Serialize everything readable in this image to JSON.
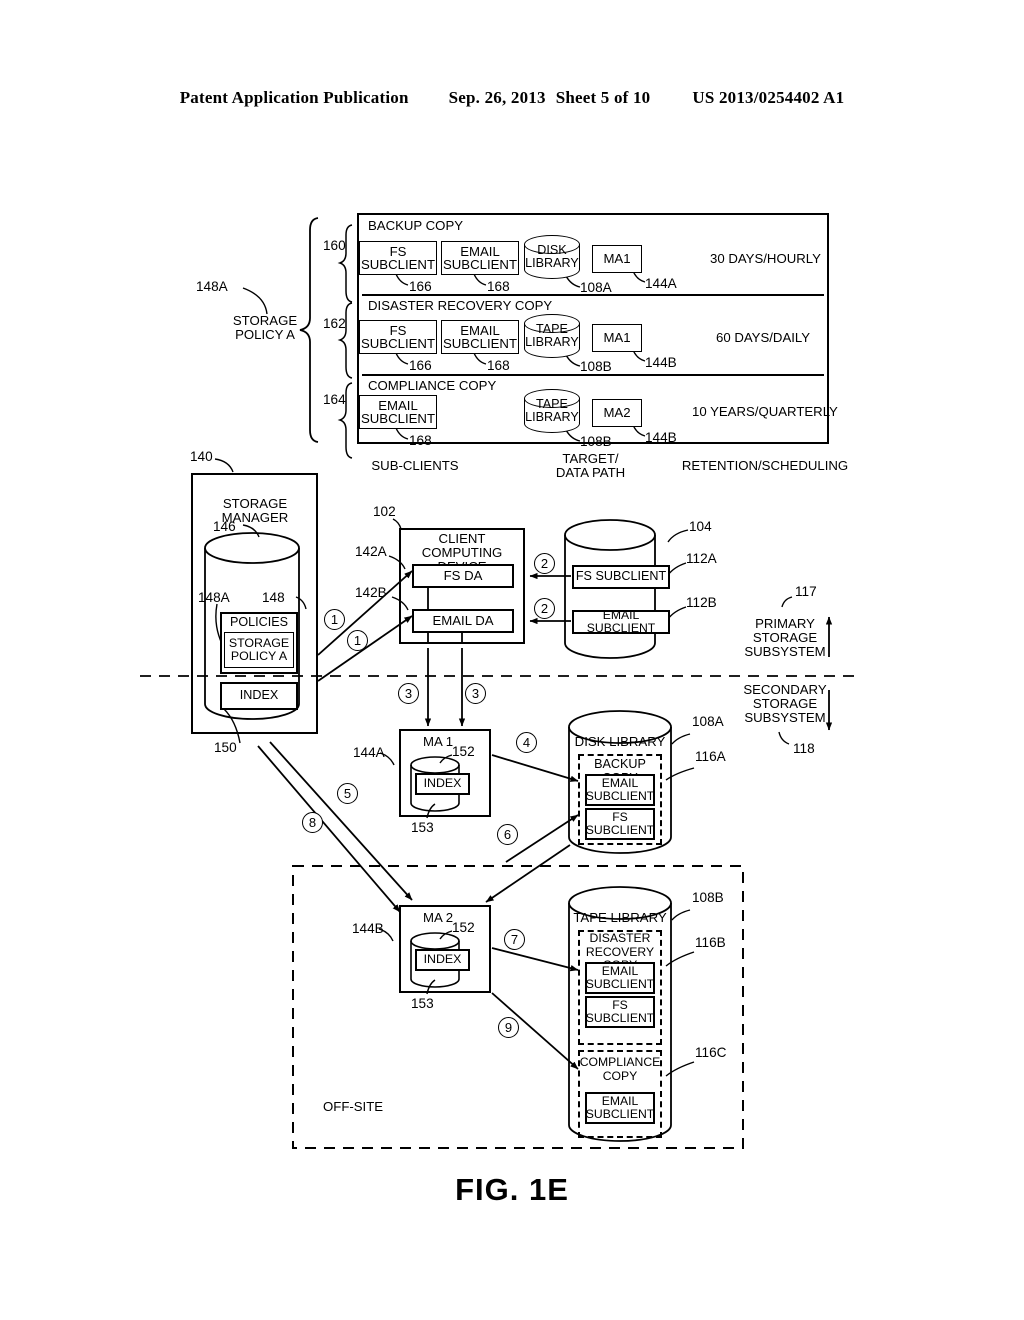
{
  "header": {
    "publication": "Patent Application Publication",
    "date": "Sep. 26, 2013",
    "sheet": "Sheet 5 of 10",
    "patent_number": "US 2013/0254402 A1"
  },
  "figure_caption": "FIG. 1E",
  "storage_policy": {
    "label_line1": "STORAGE",
    "label_line2": "POLICY A",
    "ref": "148A",
    "column_headers": {
      "subclients": "SUB-CLIENTS",
      "target_line1": "TARGET/",
      "target_line2": "DATA PATH",
      "retention": "RETENTION/SCHEDULING"
    },
    "rows": [
      {
        "ref": "160",
        "title": "BACKUP COPY",
        "subclients": [
          {
            "line1": "FS",
            "line2": "SUBCLIENT",
            "ref": "166"
          },
          {
            "line1": "EMAIL",
            "line2": "SUBCLIENT",
            "ref": "168"
          }
        ],
        "library": {
          "line1": "DISK",
          "line2": "LIBRARY",
          "ref": "108A"
        },
        "media_agent": {
          "label": "MA1",
          "ref": "144A"
        },
        "retention": "30 DAYS/HOURLY"
      },
      {
        "ref": "162",
        "title": "DISASTER RECOVERY COPY",
        "subclients": [
          {
            "line1": "FS",
            "line2": "SUBCLIENT",
            "ref": "166"
          },
          {
            "line1": "EMAIL",
            "line2": "SUBCLIENT",
            "ref": "168"
          }
        ],
        "library": {
          "line1": "TAPE",
          "line2": "LIBRARY",
          "ref": "108B"
        },
        "media_agent": {
          "label": "MA1",
          "ref": "144B"
        },
        "retention": "60 DAYS/DAILY"
      },
      {
        "ref": "164",
        "title": "COMPLIANCE COPY",
        "subclients": [
          {
            "line1": "EMAIL",
            "line2": "SUBCLIENT",
            "ref": "168"
          }
        ],
        "library": {
          "line1": "TAPE",
          "line2": "LIBRARY",
          "ref": "108B"
        },
        "media_agent": {
          "label": "MA2",
          "ref": "144B"
        },
        "retention": "10 YEARS/QUARTERLY"
      }
    ]
  },
  "storage_manager": {
    "ref": "140",
    "title_line1": "STORAGE",
    "title_line2": "MANAGER",
    "db_ref": "146",
    "policies_label": "POLICIES",
    "policies_ref": "148",
    "policy_a_line1": "STORAGE",
    "policy_a_line2": "POLICY A",
    "policy_a_ref": "148A",
    "index_label": "INDEX",
    "index_ref": "150"
  },
  "client": {
    "ref": "102",
    "title_line1": "CLIENT COMPUTING",
    "title_line2": "DEVICE",
    "fs_da": {
      "label": "FS DA",
      "ref": "142A"
    },
    "email_da": {
      "label": "EMAIL DA",
      "ref": "142B"
    }
  },
  "primary_data": {
    "ref": "104",
    "fs_subclient": {
      "label": "FS SUBCLIENT",
      "ref": "112A"
    },
    "email_subclient": {
      "label": "EMAIL SUBCLIENT",
      "ref": "112B"
    }
  },
  "subsystems": {
    "primary": {
      "line1": "PRIMARY",
      "line2": "STORAGE",
      "line3": "SUBSYSTEM",
      "ref": "117"
    },
    "secondary": {
      "line1": "SECONDARY",
      "line2": "STORAGE",
      "line3": "SUBSYSTEM",
      "ref": "118"
    }
  },
  "media_agent_1": {
    "label": "MA 1",
    "ref": "144A",
    "db_ref": "152",
    "index_label": "INDEX",
    "index_ref": "153"
  },
  "media_agent_2": {
    "label": "MA 2",
    "ref": "144B",
    "db_ref": "152",
    "index_label": "INDEX",
    "index_ref": "153"
  },
  "disk_library": {
    "title": "DISK LIBRARY",
    "ref": "108A",
    "copy": {
      "title": "BACKUP COPY",
      "ref": "116A",
      "items": [
        {
          "line1": "EMAIL",
          "line2": "SUBCLIENT"
        },
        {
          "line1": "FS",
          "line2": "SUBCLIENT"
        }
      ]
    }
  },
  "tape_library": {
    "title": "TAPE LIBRARY",
    "ref": "108B",
    "dr_copy": {
      "title_line1": "DISASTER",
      "title_line2": "RECOVERY COPY",
      "ref": "116B",
      "items": [
        {
          "line1": "EMAIL",
          "line2": "SUBCLIENT"
        },
        {
          "line1": "FS",
          "line2": "SUBCLIENT"
        }
      ]
    },
    "compliance_copy": {
      "title_line1": "COMPLIANCE",
      "title_line2": "COPY",
      "ref": "116C",
      "items": [
        {
          "line1": "EMAIL",
          "line2": "SUBCLIENT"
        }
      ]
    }
  },
  "offsite_label": "OFF-SITE",
  "steps": {
    "s1a": "1",
    "s1b": "1",
    "s2a": "2",
    "s2b": "2",
    "s3a": "3",
    "s3b": "3",
    "s4": "4",
    "s5": "5",
    "s6": "6",
    "s7": "7",
    "s8": "8",
    "s9": "9"
  }
}
